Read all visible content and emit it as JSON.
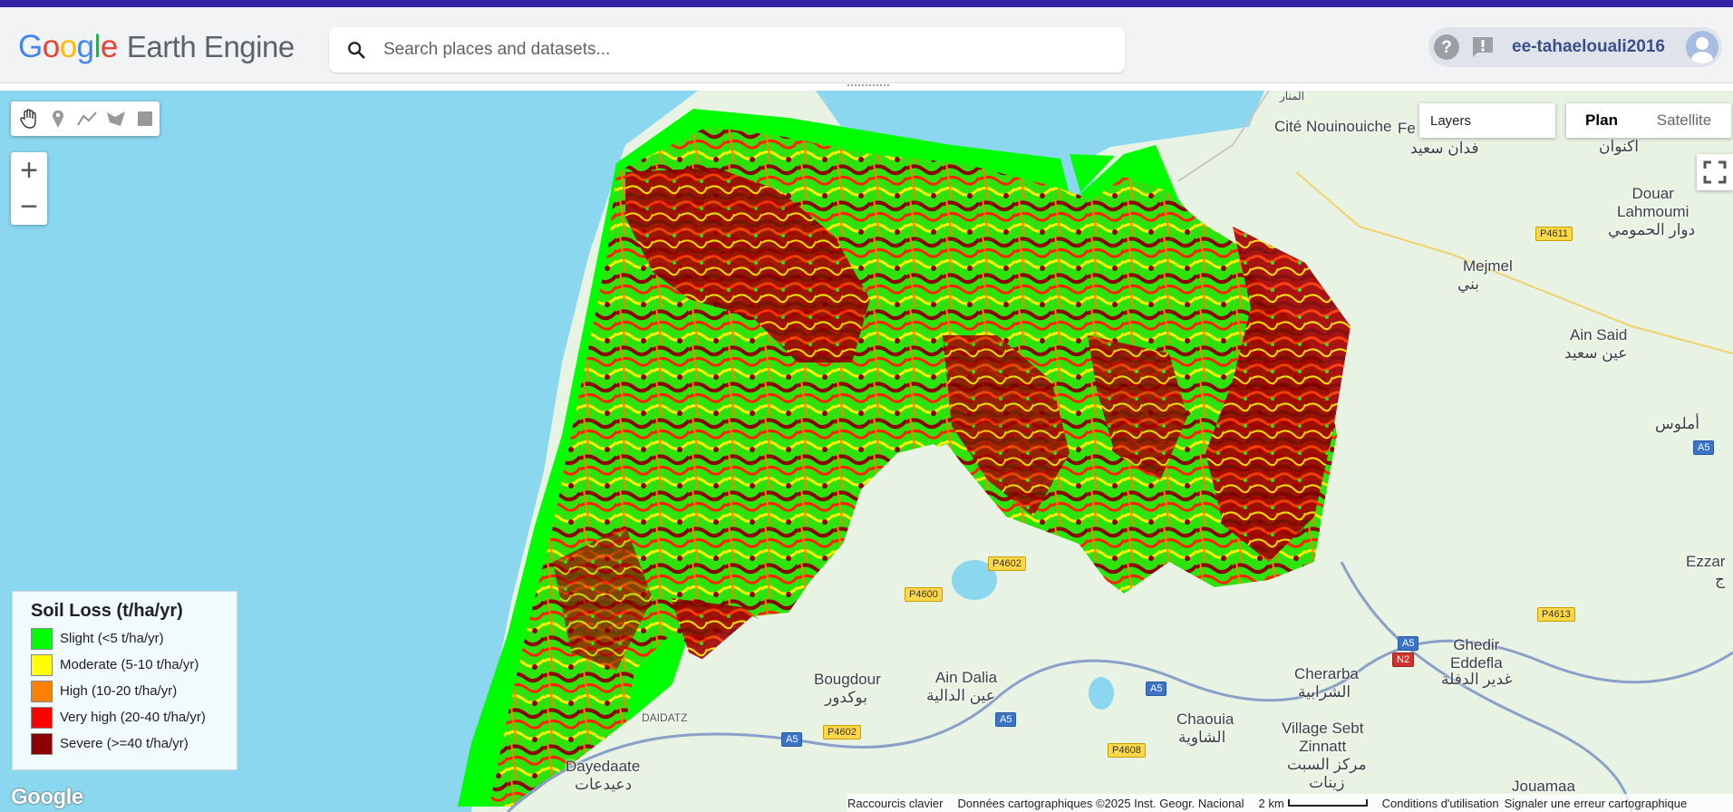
{
  "header": {
    "logo_google": [
      "G",
      "o",
      "o",
      "g",
      "l",
      "e"
    ],
    "logo_product": "Earth Engine",
    "search_placeholder": "Search places and datasets...",
    "username": "ee-tahaelouali2016"
  },
  "map_controls": {
    "layers_label": "Layers",
    "map_type_plan": "Plan",
    "map_type_satellite": "Satellite",
    "zoom_in": "+",
    "zoom_out": "−"
  },
  "legend": {
    "title": "Soil Loss (t/ha/yr)",
    "items": [
      {
        "label": "Slight (<5 t/ha/yr)",
        "color": "#00ff00"
      },
      {
        "label": "Moderate (5-10 t/ha/yr)",
        "color": "#ffff00"
      },
      {
        "label": "High (10-20 t/ha/yr)",
        "color": "#ff8000"
      },
      {
        "label": "Very high (20-40 t/ha/yr)",
        "color": "#ff0000"
      },
      {
        "label": "Severe (>=40 t/ha/yr)",
        "color": "#8b0000"
      }
    ]
  },
  "places": {
    "cite_nouinouiche": "Cité\nNouinouiche",
    "fed_arabic": "فدان سعيد",
    "fe": "Fe",
    "aknouan": "اكنوان",
    "douar_lahmoumi": "Douar\nLahmoumi",
    "douar_lahmoumi_ar": "دوار الحمومي",
    "mejmel": "Mejmel",
    "mejmel_ar": "بني",
    "ain_said": "Ain Said",
    "ain_said_ar": "عين سعيد",
    "amlous": "أملوس",
    "ezzar": "Ezzar",
    "ezzar_ar": "ج",
    "ghedir": "Ghedir\nEddefla",
    "ghedir_ar": "غدير الدفلة",
    "cherarba": "Cherarba",
    "cherarba_ar": "الشرابية",
    "bougdour": "Bougdour",
    "bougdour_ar": "بوكدور",
    "ain_dalia": "Ain Dalia",
    "ain_dalia_ar": "عين الدالية",
    "chaouia": "Chaouia",
    "chaouia_ar": "الشاوية",
    "village_sebt": "Village Sebt\nZinnatt",
    "village_sebt_ar": "مركز السبت\nزينات",
    "daidatz": "DAIDATZ",
    "dayedaate": "Dayedaate",
    "dayedaate_ar": "دعيدعات",
    "jouamaa": "Jouamaa",
    "almanar": "المنار"
  },
  "roads": {
    "p4611": "P4611",
    "p4602a": "P4602",
    "p4600": "P4600",
    "p4602b": "P4602",
    "p4608": "P4608",
    "p4613": "P4613",
    "a5_1": "A5",
    "a5_2": "A5",
    "a5_3": "A5",
    "a5_4": "A5",
    "a5_5": "A5",
    "n2": "N2"
  },
  "attribution": {
    "google": "Google",
    "shortcuts": "Raccourcis clavier",
    "map_data": "Données cartographiques ©2025 Inst. Geogr. Nacional",
    "scale": "2 km",
    "terms": "Conditions d'utilisation",
    "report": "Signaler une erreur cartographique"
  },
  "colors": {
    "topbar": "#3423a6",
    "sea": "#8ad7ef",
    "land": "#e8f3e4"
  }
}
